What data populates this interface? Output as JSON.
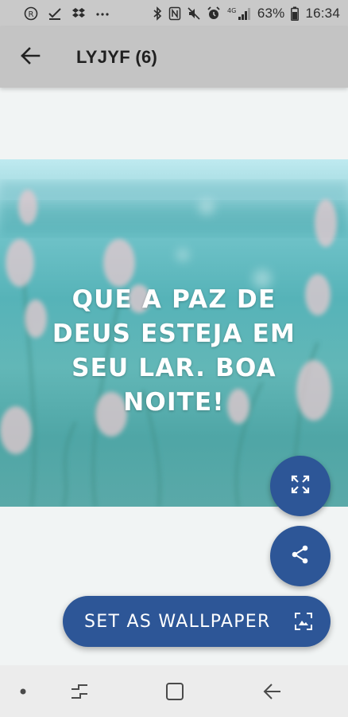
{
  "status_bar": {
    "battery_percent": "63%",
    "time": "16:34",
    "network_label": "4G",
    "icons": [
      "r-circle-icon",
      "download-check-icon",
      "dropbox-icon",
      "more-dots-icon",
      "bluetooth-icon",
      "nfc-icon",
      "mute-icon",
      "alarm-icon",
      "signal-icon",
      "battery-icon"
    ]
  },
  "app_bar": {
    "title": "LYJYF (6)",
    "back_icon": "arrow-left-icon"
  },
  "image": {
    "quote": "QUE A PAZ DE DEUS ESTEJA EM SEU LAR. BOA NOITE!",
    "colors": {
      "top": "#bfeaf0",
      "main": "#56b3b8",
      "flowers": "#e8c9cf"
    }
  },
  "actions": {
    "fullscreen_icon": "fullscreen-icon",
    "share_icon": "share-icon",
    "set_wallpaper_label": "SET AS WALLPAPER",
    "wallpaper_icon": "wallpaper-icon",
    "accent_color": "#2d5697"
  },
  "nav_bar": {
    "items": [
      "dot-icon",
      "recents-icon",
      "home-icon",
      "back-nav-icon"
    ]
  }
}
